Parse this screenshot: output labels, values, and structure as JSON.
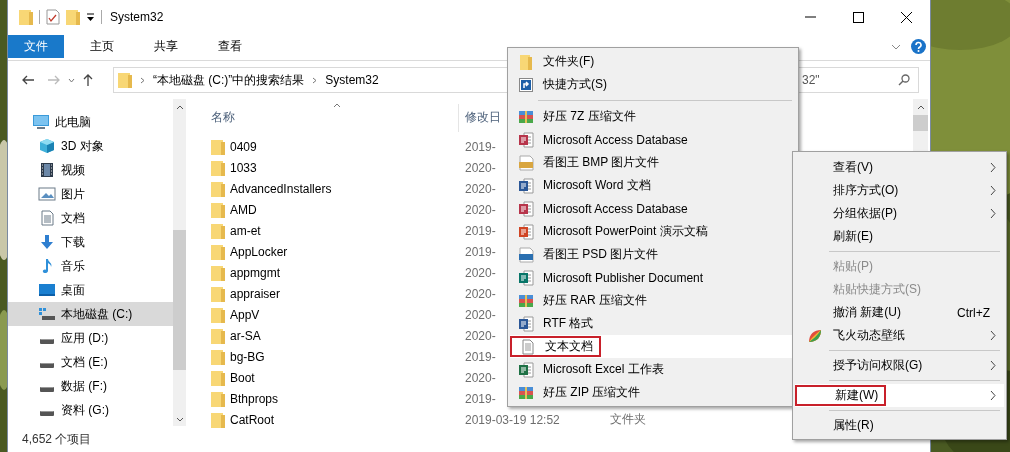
{
  "window": {
    "title": "System32"
  },
  "ribbon": {
    "tabs": [
      {
        "label": "文件",
        "selected": true
      },
      {
        "label": "主页",
        "selected": false
      },
      {
        "label": "共享",
        "selected": false
      },
      {
        "label": "查看",
        "selected": false
      }
    ]
  },
  "address_bar": {
    "breadcrumb": [
      "“本地磁盘 (C:)”中的搜索结果",
      "System32"
    ],
    "search": {
      "value": "32\""
    }
  },
  "nav_pane": {
    "items": [
      {
        "label": "此电脑",
        "kind": "pc",
        "selected": false,
        "children": [
          {
            "label": "3D 对象",
            "kind": "cube",
            "selected": false
          },
          {
            "label": "视频",
            "kind": "video",
            "selected": false
          },
          {
            "label": "图片",
            "kind": "pictures",
            "selected": false
          },
          {
            "label": "文档",
            "kind": "documents",
            "selected": false
          },
          {
            "label": "下载",
            "kind": "downloads",
            "selected": false
          },
          {
            "label": "音乐",
            "kind": "music",
            "selected": false
          },
          {
            "label": "桌面",
            "kind": "desktop",
            "selected": false
          },
          {
            "label": "本地磁盘 (C:)",
            "kind": "system-drive",
            "selected": true
          },
          {
            "label": "应用 (D:)",
            "kind": "drive",
            "selected": false
          },
          {
            "label": "文档 (E:)",
            "kind": "drive",
            "selected": false
          },
          {
            "label": "数据 (F:)",
            "kind": "drive",
            "selected": false
          },
          {
            "label": "资料 (G:)",
            "kind": "drive",
            "selected": false
          }
        ]
      }
    ]
  },
  "file_list": {
    "columns": [
      "名称",
      "修改日"
    ],
    "rows": [
      {
        "name": "0409",
        "date": "2019-"
      },
      {
        "name": "1033",
        "date": "2020-"
      },
      {
        "name": "AdvancedInstallers",
        "date": "2020-"
      },
      {
        "name": "AMD",
        "date": "2020-"
      },
      {
        "name": "am-et",
        "date": "2019-"
      },
      {
        "name": "AppLocker",
        "date": "2019-"
      },
      {
        "name": "appmgmt",
        "date": "2020-"
      },
      {
        "name": "appraiser",
        "date": "2020-"
      },
      {
        "name": "AppV",
        "date": "2020-"
      },
      {
        "name": "ar-SA",
        "date": "2020-"
      },
      {
        "name": "bg-BG",
        "date": "2019-"
      },
      {
        "name": "Boot",
        "date": "2020-"
      },
      {
        "name": "Bthprops",
        "date": "2019-"
      },
      {
        "name": "CatRoot",
        "date": "2019-03-19 12:52",
        "type": "文件夹"
      }
    ]
  },
  "status_bar": {
    "item_count": "4,652 个项目"
  },
  "new_submenu": {
    "items": [
      {
        "kind": "folder",
        "label": "文件夹(F)",
        "highlighted": false,
        "marked": false
      },
      {
        "kind": "shortcut",
        "label": "快捷方式(S)",
        "highlighted": false,
        "marked": false
      },
      {
        "kind": "separator"
      },
      {
        "kind": "archive",
        "label": "好压 7Z 压缩文件",
        "highlighted": false,
        "marked": false
      },
      {
        "kind": "access",
        "label": "Microsoft Access Database",
        "highlighted": false,
        "marked": false
      },
      {
        "kind": "bmp",
        "label": "看图王 BMP 图片文件",
        "highlighted": false,
        "marked": false
      },
      {
        "kind": "word",
        "label": "Microsoft Word 文档",
        "highlighted": false,
        "marked": false
      },
      {
        "kind": "access",
        "label": "Microsoft Access Database",
        "highlighted": false,
        "marked": false
      },
      {
        "kind": "powerpoint",
        "label": "Microsoft PowerPoint 演示文稿",
        "highlighted": false,
        "marked": false
      },
      {
        "kind": "psd",
        "label": "看图王 PSD 图片文件",
        "highlighted": false,
        "marked": false
      },
      {
        "kind": "publisher",
        "label": "Microsoft Publisher Document",
        "highlighted": false,
        "marked": false
      },
      {
        "kind": "archive",
        "label": "好压 RAR 压缩文件",
        "highlighted": false,
        "marked": false
      },
      {
        "kind": "word",
        "label": "RTF 格式",
        "highlighted": false,
        "marked": false
      },
      {
        "kind": "text",
        "label": "文本文档",
        "highlighted": true,
        "marked": true
      },
      {
        "kind": "excel",
        "label": "Microsoft Excel 工作表",
        "highlighted": false,
        "marked": false
      },
      {
        "kind": "archive",
        "label": "好压 ZIP 压缩文件",
        "highlighted": false,
        "marked": false
      }
    ]
  },
  "context_menu": {
    "items": [
      {
        "kind": "item",
        "label": "查看(V)",
        "submenu": true,
        "disabled": false,
        "highlighted": false,
        "marked": false
      },
      {
        "kind": "item",
        "label": "排序方式(O)",
        "submenu": true,
        "disabled": false,
        "highlighted": false,
        "marked": false
      },
      {
        "kind": "item",
        "label": "分组依据(P)",
        "submenu": true,
        "disabled": false,
        "highlighted": false,
        "marked": false
      },
      {
        "kind": "item",
        "label": "刷新(E)",
        "submenu": false,
        "disabled": false,
        "highlighted": false,
        "marked": false
      },
      {
        "kind": "separator"
      },
      {
        "kind": "item",
        "label": "粘贴(P)",
        "submenu": false,
        "disabled": true,
        "highlighted": false,
        "marked": false
      },
      {
        "kind": "item",
        "label": "粘贴快捷方式(S)",
        "submenu": false,
        "disabled": true,
        "highlighted": false,
        "marked": false
      },
      {
        "kind": "item",
        "label": "撤消 新建(U)",
        "shortcut": "Ctrl+Z",
        "submenu": false,
        "disabled": false,
        "highlighted": false,
        "marked": false
      },
      {
        "kind": "wallpaper",
        "label": "飞火动态壁纸",
        "submenu": true,
        "disabled": false,
        "highlighted": false,
        "marked": false
      },
      {
        "kind": "separator"
      },
      {
        "kind": "item",
        "label": "授予访问权限(G)",
        "submenu": true,
        "disabled": false,
        "highlighted": false,
        "marked": false
      },
      {
        "kind": "separator"
      },
      {
        "kind": "item",
        "label": "新建(W)",
        "submenu": true,
        "disabled": false,
        "highlighted": true,
        "marked": true
      },
      {
        "kind": "separator"
      },
      {
        "kind": "item",
        "label": "属性(R)",
        "submenu": false,
        "disabled": false,
        "highlighted": false,
        "marked": false
      }
    ]
  }
}
